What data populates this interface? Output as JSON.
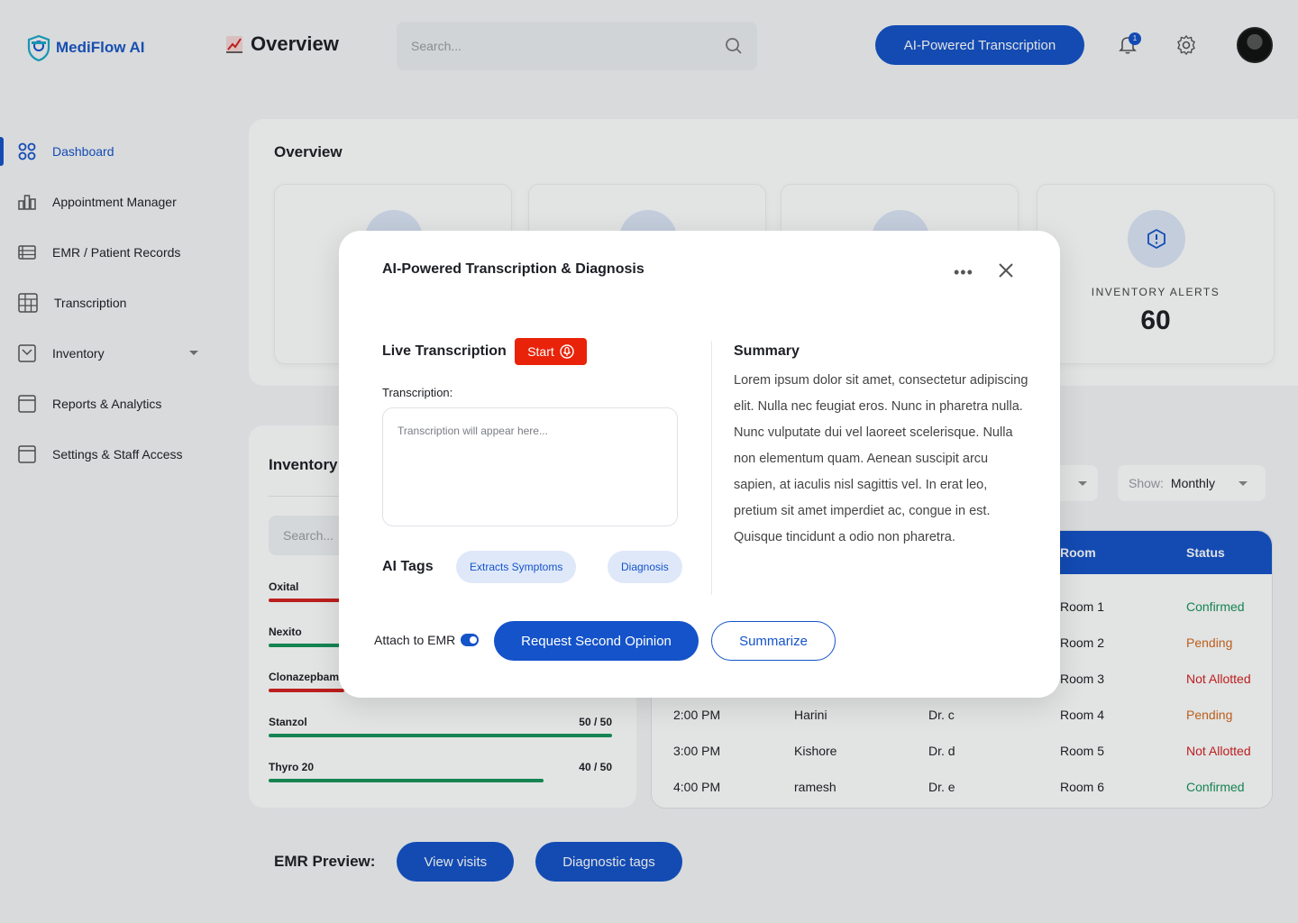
{
  "header": {
    "logo_text": "MediFlow  AI",
    "page_title": "Overview",
    "search_placeholder": "Search...",
    "cta_label": "AI-Powered Transcription",
    "notification_count": "1"
  },
  "sidebar": {
    "items": [
      {
        "label": "Dashboard",
        "icon": "grid-icon",
        "active": true
      },
      {
        "label": "Appointment Manager",
        "icon": "bar-chart-icon"
      },
      {
        "label": "EMR / Patient Records",
        "icon": "records-icon"
      },
      {
        "label": "Transcription",
        "icon": "table-icon"
      },
      {
        "label": "Inventory",
        "icon": "inventory-icon",
        "has_dropdown": true
      },
      {
        "label": "Reports & Analytics",
        "icon": "window-icon"
      },
      {
        "label": "Settings & Staff Access",
        "icon": "window-icon"
      }
    ]
  },
  "overview": {
    "title": "Overview",
    "inventory_alerts": {
      "label": "INVENTORY ALERTS",
      "value": "60"
    }
  },
  "inventory": {
    "title": "Inventory",
    "search_placeholder": "Search...",
    "items": [
      {
        "name": "Oxital",
        "count": "",
        "fill": 0.3,
        "color": "#d3201f"
      },
      {
        "name": "Nexito",
        "count": "",
        "fill": 0.4,
        "color": "#16935a"
      },
      {
        "name": "Clonazepbam",
        "count": "",
        "fill": 0.22,
        "color": "#d3201f"
      },
      {
        "name": "Stanzol",
        "count": "50 / 50",
        "fill": 1.0,
        "color": "#16935a"
      },
      {
        "name": "Thyro 20",
        "count": "40 / 50",
        "fill": 0.8,
        "color": "#16935a"
      }
    ]
  },
  "filters": {
    "show_label": "Show:",
    "show_value": "Monthly"
  },
  "appointments": {
    "columns": {
      "room": "Room",
      "status": "Status"
    },
    "rows": [
      {
        "time": "",
        "name": "",
        "doctor": "",
        "room": "Room 1",
        "status": "Confirmed",
        "status_color": "#16935a"
      },
      {
        "time": "",
        "name": "",
        "doctor": "",
        "room": "Room 2",
        "status": "Pending",
        "status_color": "#d2691e"
      },
      {
        "time": "",
        "name": "",
        "doctor": "",
        "room": "Room 3",
        "status": "Not Allotted",
        "status_color": "#d3201f"
      },
      {
        "time": "2:00 PM",
        "name": "Harini",
        "doctor": "Dr. c",
        "room": "Room 4",
        "status": "Pending",
        "status_color": "#d2691e"
      },
      {
        "time": "3:00 PM",
        "name": "Kishore",
        "doctor": "Dr. d",
        "room": "Room 5",
        "status": "Not Allotted",
        "status_color": "#d3201f"
      },
      {
        "time": "4:00 PM",
        "name": "ramesh",
        "doctor": "Dr. e",
        "room": "Room 6",
        "status": "Confirmed",
        "status_color": "#16935a"
      }
    ]
  },
  "emr_preview": {
    "label": "EMR Preview:",
    "view_visits": "View visits",
    "diagnostic_tags": "Diagnostic tags"
  },
  "modal": {
    "title": "AI-Powered Transcription & Diagnosis",
    "more_label": "•••",
    "live_label": "Live Transcription",
    "start_label": "Start",
    "transcription_label": "Transcription:",
    "transcription_placeholder": "Transcription will appear here...",
    "tags_label": "AI Tags",
    "tags": [
      "Extracts Symptoms",
      "Diagnosis"
    ],
    "summary_title": "Summary",
    "summary_text": "Lorem ipsum dolor sit amet, consectetur adipiscing elit. Nulla nec feugiat eros. Nunc in pharetra nulla. Nunc vulputate dui vel laoreet scelerisque. Nulla non elementum quam. Aenean suscipit arcu sapien, at iaculis nisl sagittis vel. In erat leo, pretium sit amet imperdiet ac, congue in est. Quisque tincidunt a odio non pharetra.",
    "attach_label": "Attach to EMR",
    "second_opinion_label": "Request Second Opinion",
    "summarize_label": "Summarize"
  },
  "colors": {
    "primary": "#1453c9",
    "danger": "#e8230a"
  }
}
